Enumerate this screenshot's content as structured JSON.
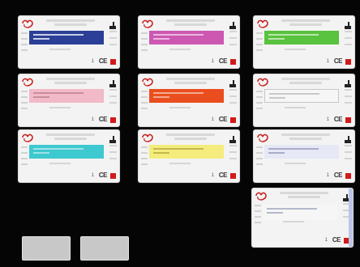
{
  "colors": {
    "background": "#050505",
    "card": "#f3f3f3",
    "logo_red": "#c8201f",
    "badge_red": "#d21a1a"
  },
  "cards": [
    {
      "id": "1",
      "band_color": "#2b3f96",
      "band_line_color": "#c9cde8",
      "outlined": false
    },
    {
      "id": "2",
      "band_color": "#cc58b2",
      "band_line_color": "#ecb7de",
      "outlined": false
    },
    {
      "id": "3",
      "band_color": "#59c23e",
      "band_line_color": "#b9e6ac",
      "outlined": false
    },
    {
      "id": "4",
      "band_color": "#f2b9c8",
      "band_line_color": "#c98e9c",
      "outlined": false
    },
    {
      "id": "5",
      "band_color": "#ea4e1e",
      "band_line_color": "#f4a98f",
      "outlined": false
    },
    {
      "id": "6",
      "band_color": "#f6f6f6",
      "band_line_color": "#c9c9c9",
      "outlined": true
    },
    {
      "id": "7",
      "band_color": "#3ec8cf",
      "band_line_color": "#9fe2e6",
      "outlined": false
    },
    {
      "id": "8",
      "band_color": "#f4ec7c",
      "band_line_color": "#c4b84c",
      "outlined": false
    },
    {
      "id": "9",
      "band_color": "#e6e8f6",
      "band_line_color": "#a8acc8",
      "outlined": false
    },
    {
      "id": "10",
      "band_color": "#f6f6f6",
      "band_line_color": "#b4b8cc",
      "outlined": false
    }
  ],
  "marks": {
    "count_label": "1",
    "ce_label": "CE"
  },
  "buttons": {
    "left_label": "",
    "right_label": ""
  }
}
